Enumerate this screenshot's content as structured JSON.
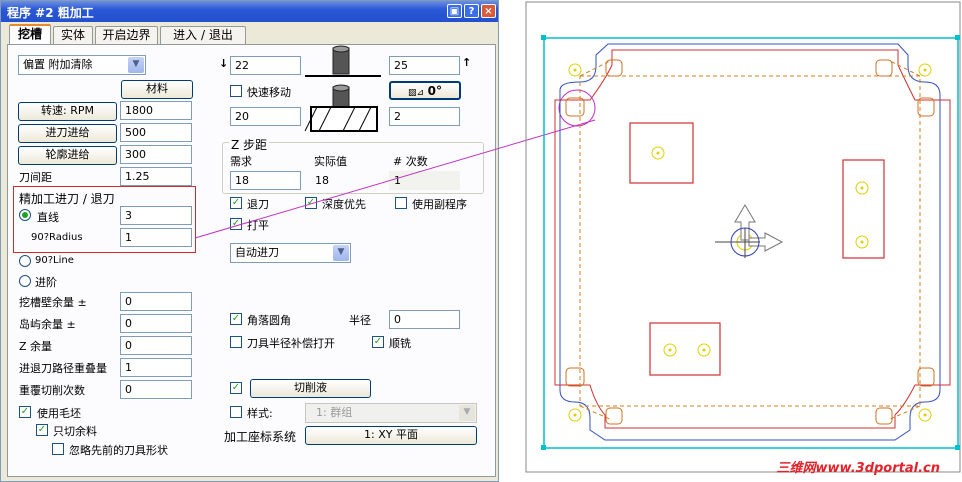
{
  "window": {
    "title": "程序 #2 粗加工",
    "help_glyph": "?",
    "close_glyph": "×"
  },
  "tabs": [
    {
      "label": "挖槽",
      "active": true
    },
    {
      "label": "实体",
      "active": false
    },
    {
      "label": "开启边界",
      "active": false
    },
    {
      "label": "进入 / 退出",
      "active": false
    }
  ],
  "left": {
    "offset_select": "偏置 附加清除",
    "material_button": "材料",
    "speed_button": "转速: RPM",
    "speed_value": "1800",
    "feed_button": "进刀进给",
    "feed_value": "500",
    "contour_feed_button": "轮廓进给",
    "contour_feed_value": "300",
    "stepover_label": "刀间距",
    "stepover_value": "1.25",
    "finish_group_label": "精加工进刀 / 退刀",
    "line_radio": "直线",
    "line_value": "3",
    "radius_label": "90?Radius",
    "radius_value": "1",
    "line90_radio": "90?Line",
    "step_radio": "进阶",
    "wall_stock_label": "挖槽壁余量 ±",
    "wall_stock_value": "0",
    "island_stock_label": "岛屿余量 ±",
    "island_stock_value": "0",
    "z_stock_label": "Z 余量",
    "z_stock_value": "0",
    "overlap_label": "进退刀路径重叠量",
    "overlap_value": "1",
    "repeat_label": "重覆切削次数",
    "repeat_value": "0",
    "use_blank_check": "使用毛坯",
    "only_rest_check": "只切余料",
    "ignore_prev_check": "忽略先前的刀具形状"
  },
  "right": {
    "top_value": "22",
    "right_top_value": "25",
    "rapid_check": "快速移动",
    "angle_button": "0°",
    "bottom_value": "20",
    "right_bottom_value": "2",
    "zstep_group": "Z 步距",
    "col_required": "需求",
    "col_actual": "实际值",
    "col_count": "# 次数",
    "req_value": "18",
    "actual_value": "18",
    "count_value": "1",
    "retract_check": "退刀",
    "depth_first_check": "深度优先",
    "subprogram_check": "使用副程序",
    "plunge_check": "打平",
    "auto_entry_select": "自动进刀",
    "corner_round_check": "角落圆角",
    "radius_label": "半径",
    "radius_value": "0",
    "cutter_comp_check": "刀具半径补偿打开",
    "climb_check": "顺铣",
    "coolant_button": "切削液",
    "style_check": "样式:",
    "style_select": "1: 群组",
    "coord_label": "加工座标系统",
    "coord_button": "1: XY 平面"
  },
  "watermark": "三维网www.3dportal.cn",
  "colors": {
    "title_bar": "#2350cc",
    "highlight": "#d42c2c",
    "accent_line": "#c030c0",
    "boundary": "#00c0d0",
    "pocket": "#d03030",
    "tool": "#3040b0"
  }
}
